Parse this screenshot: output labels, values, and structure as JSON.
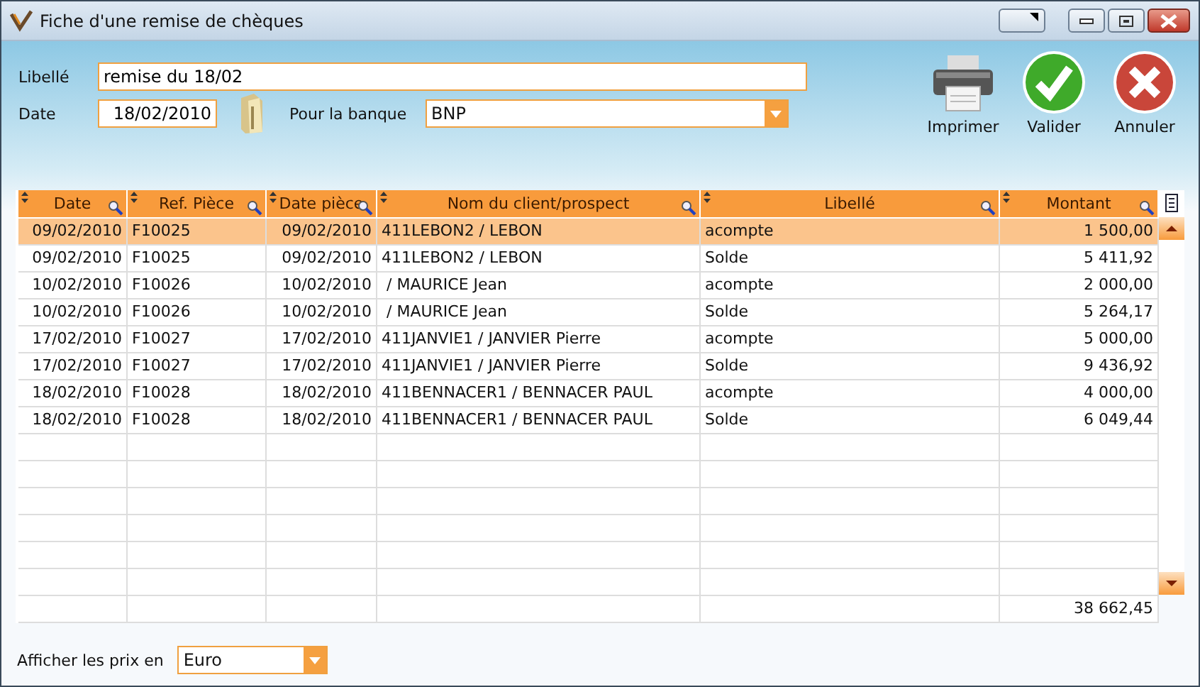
{
  "window": {
    "title": "Fiche d'une remise de chèques"
  },
  "form": {
    "libelle_label": "Libellé",
    "libelle_value": "remise du 18/02",
    "date_label": "Date",
    "date_value": "18/02/2010",
    "bank_label": "Pour la banque",
    "bank_value": "BNP"
  },
  "actions": [
    {
      "kind": "print",
      "label": "Imprimer"
    },
    {
      "kind": "ok",
      "label": "Valider"
    },
    {
      "kind": "cancel",
      "label": "Annuler"
    }
  ],
  "table": {
    "columns": [
      "Date",
      "Ref. Pièce",
      "Date pièce",
      "Nom du client/prospect",
      "Libellé",
      "Montant"
    ],
    "rows": [
      {
        "cells": [
          "09/02/2010",
          "F10025",
          "09/02/2010",
          "411LEBON2 / LEBON",
          "acompte",
          "1 500,00"
        ],
        "selected": true
      },
      {
        "cells": [
          "09/02/2010",
          "F10025",
          "09/02/2010",
          "411LEBON2 / LEBON",
          "Solde",
          "5 411,92"
        ],
        "selected": false
      },
      {
        "cells": [
          "10/02/2010",
          "F10026",
          "10/02/2010",
          " / MAURICE Jean",
          "acompte",
          "2 000,00"
        ],
        "selected": false
      },
      {
        "cells": [
          "10/02/2010",
          "F10026",
          "10/02/2010",
          " / MAURICE Jean",
          "Solde",
          "5 264,17"
        ],
        "selected": false
      },
      {
        "cells": [
          "17/02/2010",
          "F10027",
          "17/02/2010",
          "411JANVIE1 / JANVIER Pierre",
          "acompte",
          "5 000,00"
        ],
        "selected": false
      },
      {
        "cells": [
          "17/02/2010",
          "F10027",
          "17/02/2010",
          "411JANVIE1 / JANVIER Pierre",
          "Solde",
          "9 436,92"
        ],
        "selected": false
      },
      {
        "cells": [
          "18/02/2010",
          "F10028",
          "18/02/2010",
          "411BENNACER1 / BENNACER PAUL",
          "acompte",
          "4 000,00"
        ],
        "selected": false
      },
      {
        "cells": [
          "18/02/2010",
          "F10028",
          "18/02/2010",
          "411BENNACER1 / BENNACER PAUL",
          "Solde",
          "6 049,44"
        ],
        "selected": false
      }
    ],
    "total": "38 662,45"
  },
  "footer": {
    "label": "Afficher les prix en",
    "value": "Euro"
  }
}
